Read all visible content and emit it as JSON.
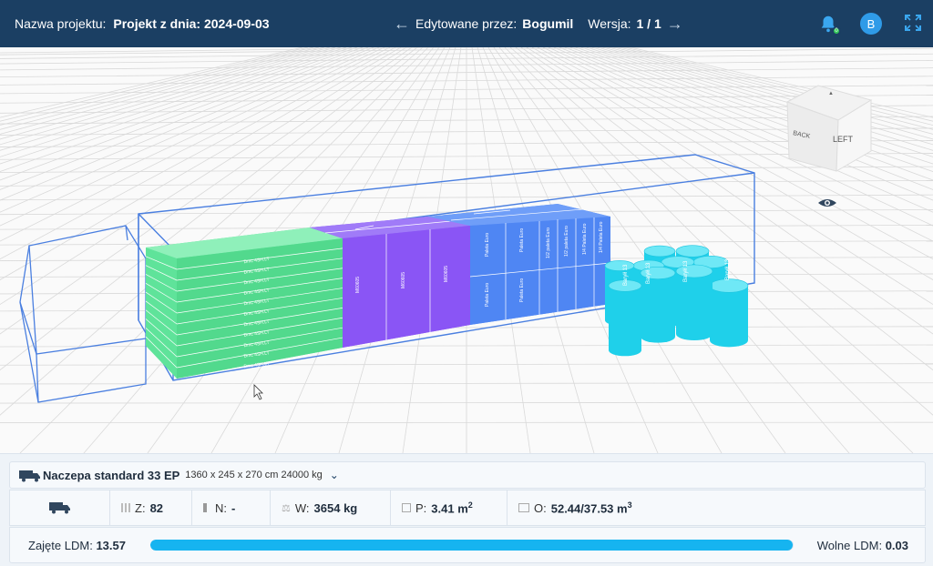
{
  "header": {
    "project_label": "Nazwa projektu:",
    "project_name": "Projekt z dnia: 2024-09-03",
    "edited_label": "Edytowane przez:",
    "edited_by": "Bogumil",
    "version_label": "Wersja:",
    "version_value": "1 / 1",
    "notification_count": "0",
    "avatar_letter": "B"
  },
  "viewport": {
    "nav_cube": {
      "front": "LEFT",
      "side": "BACK"
    },
    "cargo_labels": {
      "green": "Dmc 4SH.LT",
      "purple": "M60605",
      "blue_top": "Paleta Euro",
      "blue_small": "1/2 paleta Euro",
      "blue_smallest": "1/4 Paleta Euro",
      "barrel": "Baryłł 13"
    }
  },
  "vehicle": {
    "name": "Naczepa standard 33 EP",
    "dims": "1360 x 245 x 270 cm 24000 kg"
  },
  "stats": {
    "z_label": "Z:",
    "z_value": "82",
    "n_label": "N:",
    "n_value": "-",
    "w_label": "W:",
    "w_value": "3654 kg",
    "p_label": "P:",
    "p_value": "3.41 m",
    "o_label": "O:",
    "o_value": "52.44/37.53 m"
  },
  "ldm": {
    "used_label": "Zajęte LDM:",
    "used_value": "13.57",
    "free_label": "Wolne LDM:",
    "free_value": "0.03",
    "fill_fraction": 0.998
  },
  "colors": {
    "header_bg": "#1b3f63",
    "green_cargo": "#5fe39a",
    "purple_cargo": "#8b5cf6",
    "blue_cargo": "#4f8ff7",
    "cyan_cargo": "#1fd6ee",
    "progress": "#16b4f0"
  }
}
